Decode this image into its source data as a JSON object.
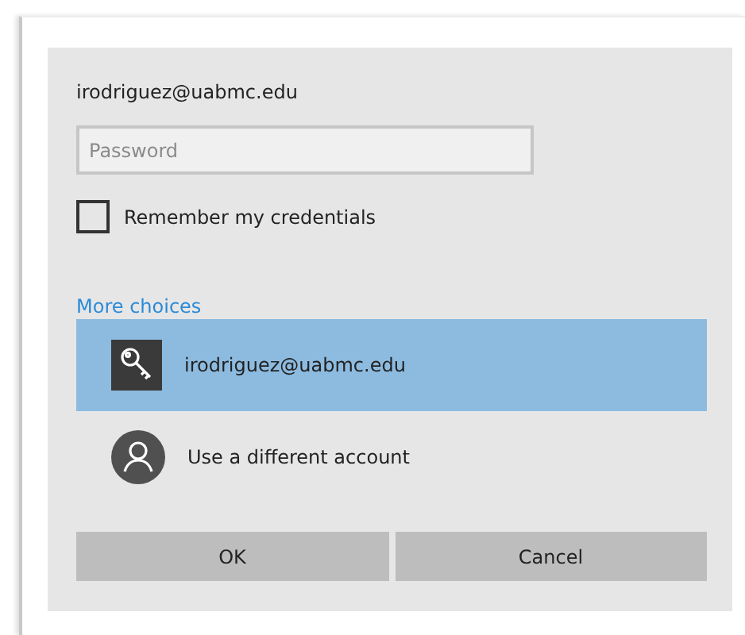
{
  "account": {
    "email": "irodriguez@uabmc.edu"
  },
  "password": {
    "placeholder": "Password"
  },
  "remember": {
    "label": "Remember my credentials",
    "checked": false
  },
  "more_choices": "More choices",
  "choices": [
    {
      "kind": "key",
      "label": "irodriguez@uabmc.edu",
      "selected": true
    },
    {
      "kind": "person",
      "label": "Use a different account",
      "selected": false
    }
  ],
  "buttons": [
    "OK",
    "Cancel"
  ]
}
